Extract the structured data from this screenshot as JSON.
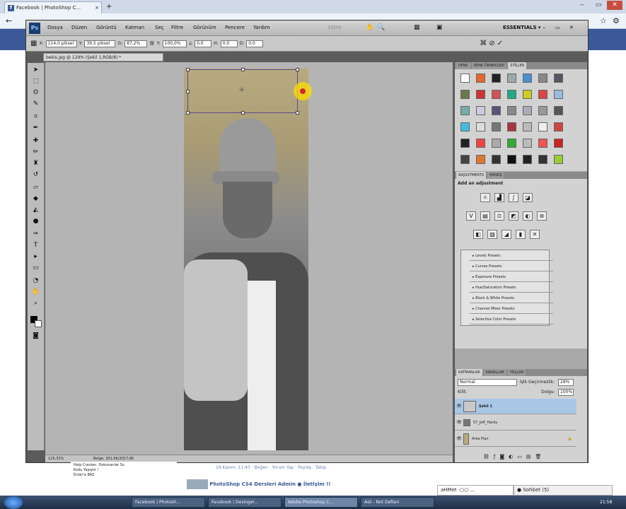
{
  "browser": {
    "tab_title": "Facebook | PhotoShop C...",
    "tab_close": "×",
    "new_tab": "+",
    "back": "←",
    "win_min": "‒",
    "win_max": "▭",
    "win_close": "✕",
    "star": "☆",
    "wrench": "⚙"
  },
  "photoshop": {
    "logo": "Ps",
    "menus": [
      "Dosya",
      "Düzen",
      "Görüntü",
      "Katman",
      "Seç",
      "Filtre",
      "Görünüm",
      "Pencere",
      "Yardım"
    ],
    "zoom_label": "100%",
    "workspace": "ESSENTIALS ▾",
    "options": {
      "x_label": "X:",
      "x_value": "114,0 piksel",
      "y_label": "Y:",
      "y_value": "39,5 piksel",
      "w_label": "G:",
      "w_value": "87,2%",
      "h_label": "Y:",
      "h_value": "100,0%",
      "angle_value": "0,0",
      "hskew_label": "H:",
      "hskew_value": "0,0",
      "vskew_label": "D:",
      "vskew_value": "0,0"
    },
    "document_tab": "bekis.jpg @ 129% (Şekil 1,RGB/8) *",
    "status_zoom": "129,33%",
    "status_doc": "Belge: 351,6K/2017,8K",
    "panels": {
      "swatch_tabs": [
        "RENK",
        "RENK ÖRNEKLERİ",
        "STİLLER"
      ],
      "adjust_tabs": [
        "ADJUSTMENTS",
        "MASKS"
      ],
      "add_adjustment": "Add an adjustment",
      "presets": [
        "Levels Presets",
        "Curves Presets",
        "Exposure Presets",
        "Hue/Saturation Presets",
        "Black & White Presets",
        "Channel Mixer Presets",
        "Selective Color Presets"
      ],
      "layer_tabs": [
        "KATMANLAR",
        "KANALLAR",
        "YOLLAR"
      ],
      "blend_mode": "Normal",
      "opacity_label": "İşlk Geçirmezlik:",
      "opacity_value": "28%",
      "lock_label": "Kilit:",
      "fill_label": "Dolgu:",
      "fill_value": "100%",
      "layers": [
        {
          "name": "Şekil 1",
          "selected": true
        },
        {
          "name": "57_Jeff_Hardy",
          "selected": false
        },
        {
          "name": "Arka Plan",
          "selected": false
        }
      ]
    }
  },
  "webpage": {
    "left_items": [
      "Help Cracker, Dokunanlar Su",
      "Kodu Yapıştır !",
      "Enter'a BAS"
    ],
    "post_meta": "19 Kasım, 11:43 · Beğen · Yorum Yap · Paylaş · Takip",
    "post_title": "PhotoShop CS4 Dersleri Admin ● İletİşİm !!",
    "chat_user": "aHMet ·○○ ... ",
    "chat_sohbet": "● Sohbet (5)"
  },
  "taskbar": {
    "tasks": [
      "Facebook | Photosh...",
      "Facebook | Desinger...",
      "Adobe Photoshop C...",
      "Aslı - Not Defteri"
    ],
    "clock": "21:58"
  },
  "colors": {
    "selection_border": "#5a4a8a",
    "layer_selected": "#a9c6e6",
    "facebook_blue": "#3b5998"
  }
}
